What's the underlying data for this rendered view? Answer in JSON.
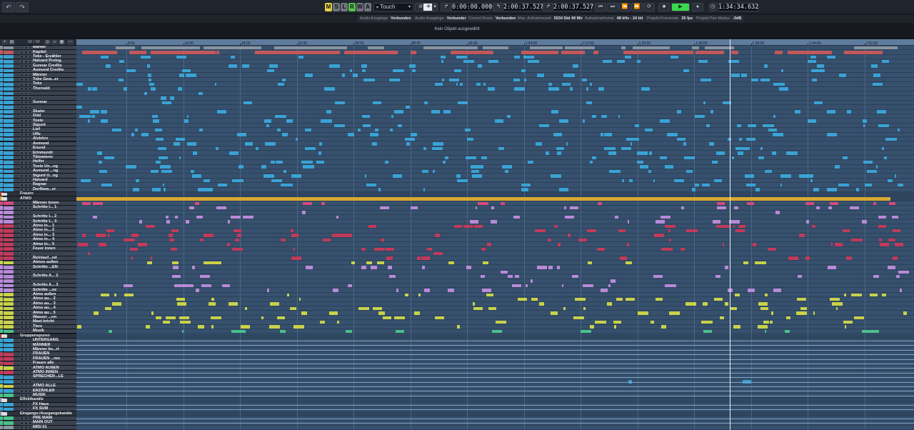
{
  "toolbar": {
    "undo_icon": "undo-icon",
    "redo_icon": "redo-icon",
    "m_label": "M",
    "s_label": "S",
    "l_label": "L",
    "r_label": "R",
    "w_label": "W",
    "a_label": "A",
    "automation_mode": "Touch",
    "time_start": "0:00:00.000",
    "time_left_locator": "2:00:37.527",
    "time_right_locator": "2:00:37.527",
    "time_position": "1:34:34.632",
    "colors": {
      "m": "#e3d14a",
      "s": "#6f757d",
      "l": "#6f757d",
      "r": "#56c150",
      "w": "#6f757d",
      "a": "#6f757d",
      "play": "#3bd94c"
    }
  },
  "status": [
    {
      "label": "Audio-Eingänge",
      "value": "Verbunden"
    },
    {
      "label": "Audio-Ausgänge",
      "value": "Verbunden"
    },
    {
      "label": "Control Room",
      "value": "Verbunden"
    },
    {
      "label": "Max. Aufnahmezeit",
      "value": "5534 Std 49 Min"
    },
    {
      "label": "Aufnahmeformat",
      "value": "48 kHz - 24 bit"
    },
    {
      "label": "Projekt-Framerate",
      "value": "25 fps"
    },
    {
      "label": "Projekt-Pan-Modus",
      "value": "-3dB"
    }
  ],
  "info_line": "Kein Objekt ausgewählt",
  "track_count": "92 / 92",
  "ruler_ticks": [
    "8:00",
    "16:00",
    "24:00",
    "32:00",
    "40:00",
    "48:00",
    "56:00",
    "1:04:00",
    "1:12:00",
    "1:20:00",
    "1:28:00",
    "1:36:00",
    "1:44:00",
    "1:52:00"
  ],
  "tracks": [
    {
      "name": "Marker",
      "color": "#8a94a0",
      "kind": "marker"
    },
    {
      "name": "Kapitel",
      "color": "#c2585a",
      "kind": "marker"
    },
    {
      "name": "Toke - Erzähler",
      "color": "#3aa3d6",
      "kind": "audio"
    },
    {
      "name": "Halvard Prolog",
      "color": "#3aa3d6",
      "kind": "audio"
    },
    {
      "name": "Gunnar Credits",
      "color": "#3aa3d6",
      "kind": "audio"
    },
    {
      "name": "Asmund Credits",
      "color": "#3aa3d6",
      "kind": "audio"
    },
    {
      "name": "Männer",
      "color": "#3aa3d6",
      "kind": "audio"
    },
    {
      "name": "Toke Gew...er",
      "color": "#3aa3d6",
      "kind": "audio"
    },
    {
      "name": "Toke",
      "color": "#3aa3d6",
      "kind": "audio"
    },
    {
      "name": "Thorvald",
      "color": "#3aa3d6",
      "kind": "audio"
    },
    {
      "name": "",
      "color": "#3aa3d6",
      "kind": "audio"
    },
    {
      "name": "",
      "color": "#3aa3d6",
      "kind": "audio"
    },
    {
      "name": "Gunnar",
      "color": "#3aa3d6",
      "kind": "audio"
    },
    {
      "name": "",
      "color": "#3aa3d6",
      "kind": "audio"
    },
    {
      "name": "Skaim",
      "color": "#3aa3d6",
      "kind": "audio"
    },
    {
      "name": "Odd",
      "color": "#3aa3d6",
      "kind": "audio"
    },
    {
      "name": "Toste",
      "color": "#3aa3d6",
      "kind": "audio"
    },
    {
      "name": "Sigurd",
      "color": "#3aa3d6",
      "kind": "audio"
    },
    {
      "name": "Lief",
      "color": "#3aa3d6",
      "kind": "audio"
    },
    {
      "name": "Uffe",
      "color": "#3aa3d6",
      "kind": "audio"
    },
    {
      "name": "Alsbörn",
      "color": "#3aa3d6",
      "kind": "audio"
    },
    {
      "name": "Asmund",
      "color": "#3aa3d6",
      "kind": "audio"
    },
    {
      "name": "Enund",
      "color": "#3aa3d6",
      "kind": "audio"
    },
    {
      "name": "Erinmundr",
      "color": "#3aa3d6",
      "kind": "audio"
    },
    {
      "name": "Tätowierer",
      "color": "#3aa3d6",
      "kind": "audio"
    },
    {
      "name": "Helfer",
      "color": "#3aa3d6",
      "kind": "audio"
    },
    {
      "name": "Toste Un...ng",
      "color": "#3aa3d6",
      "kind": "audio"
    },
    {
      "name": "Asmund ...ng",
      "color": "#3aa3d6",
      "kind": "audio"
    },
    {
      "name": "Sigurd U...ng",
      "color": "#3aa3d6",
      "kind": "audio"
    },
    {
      "name": "Halvard",
      "color": "#3aa3d6",
      "kind": "audio"
    },
    {
      "name": "Ragnar",
      "color": "#3aa3d6",
      "kind": "audio"
    },
    {
      "name": "Dorfbew...er",
      "color": "#3aa3d6",
      "kind": "audio"
    },
    {
      "name": "Frauen",
      "color": "#c23a3a",
      "kind": "folder"
    },
    {
      "name": "ATMO",
      "color": "#d9a832",
      "kind": "folder"
    },
    {
      "name": "Männer innen",
      "color": "#d64a7e",
      "kind": "audio"
    },
    {
      "name": "Schritte I... 1",
      "color": "#b98ad9",
      "kind": "audio"
    },
    {
      "name": "",
      "color": "#b98ad9",
      "kind": "audio"
    },
    {
      "name": "Schritte I... 2",
      "color": "#b98ad9",
      "kind": "audio"
    },
    {
      "name": "Schritte I... 3",
      "color": "#b98ad9",
      "kind": "audio"
    },
    {
      "name": "Atmo in... 1",
      "color": "#c23a5a",
      "kind": "audio"
    },
    {
      "name": "Atmo in... 2",
      "color": "#c23a5a",
      "kind": "audio"
    },
    {
      "name": "Atmo in... 3",
      "color": "#c23a5a",
      "kind": "audio"
    },
    {
      "name": "Atmo in... 4",
      "color": "#c23a5a",
      "kind": "audio"
    },
    {
      "name": "Atmo in... 5",
      "color": "#c23a5a",
      "kind": "audio"
    },
    {
      "name": "Feuer innen",
      "color": "#c23a5a",
      "kind": "audio"
    },
    {
      "name": "",
      "color": "#c23a5a",
      "kind": "audio"
    },
    {
      "name": "Reinlauf...nd",
      "color": "#c23a5a",
      "kind": "audio"
    },
    {
      "name": "Atmos außen",
      "color": "#c9d24a",
      "kind": "audio"
    },
    {
      "name": "Schritte ...EN",
      "color": "#b98ad9",
      "kind": "audio"
    },
    {
      "name": "",
      "color": "#b98ad9",
      "kind": "audio"
    },
    {
      "name": "Schritte A... 2",
      "color": "#b98ad9",
      "kind": "audio"
    },
    {
      "name": "",
      "color": "#b98ad9",
      "kind": "audio"
    },
    {
      "name": "Schritte A... 3",
      "color": "#b98ad9",
      "kind": "audio"
    },
    {
      "name": "Schritte ...ee",
      "color": "#b98ad9",
      "kind": "audio"
    },
    {
      "name": "Atmo außen",
      "color": "#c9d24a",
      "kind": "audio"
    },
    {
      "name": "Atmo au... 2",
      "color": "#c9d24a",
      "kind": "audio"
    },
    {
      "name": "Atmo au... 3",
      "color": "#c9d24a",
      "kind": "audio"
    },
    {
      "name": "Atmo au... 4",
      "color": "#c9d24a",
      "kind": "audio"
    },
    {
      "name": "Atmo au... 5",
      "color": "#c9d24a",
      "kind": "audio"
    },
    {
      "name": "Wasser ...rm",
      "color": "#c9d24a",
      "kind": "audio"
    },
    {
      "name": "Mast bricht",
      "color": "#c9d24a",
      "kind": "audio"
    },
    {
      "name": "Tiere",
      "color": "#c9d24a",
      "kind": "audio"
    },
    {
      "name": "Musik",
      "color": "#4ac28a",
      "kind": "audio"
    },
    {
      "name": "Gruppenspuren",
      "color": "#c23a3a",
      "kind": "folder"
    },
    {
      "name": "UNTERGANG",
      "color": "#3aa3d6",
      "kind": "group"
    },
    {
      "name": "MÄNNER",
      "color": "#3aa3d6",
      "kind": "group"
    },
    {
      "name": "Männer ko...rt",
      "color": "#3aa3d6",
      "kind": "group"
    },
    {
      "name": "FRAUEN",
      "color": "#c23a5a",
      "kind": "group"
    },
    {
      "name": "FRAUEN ...mo",
      "color": "#c23a5a",
      "kind": "group"
    },
    {
      "name": "Frauen alle",
      "color": "#c23a5a",
      "kind": "group"
    },
    {
      "name": "ATMO AUßEN",
      "color": "#c9d24a",
      "kind": "group"
    },
    {
      "name": "ATMO INNEN",
      "color": "#c23a5a",
      "kind": "group"
    },
    {
      "name": "SPRECHER...LE",
      "color": "#3aa3d6",
      "kind": "group"
    },
    {
      "name": "",
      "color": "#3aa3d6",
      "kind": "group"
    },
    {
      "name": "ATMO ALLE",
      "color": "#c9d24a",
      "kind": "group"
    },
    {
      "name": "ERZÄHLER",
      "color": "#3aa3d6",
      "kind": "group"
    },
    {
      "name": "MUSIK",
      "color": "#4ac28a",
      "kind": "group"
    },
    {
      "name": "Effektkanäle",
      "color": "#8a94a0",
      "kind": "folder"
    },
    {
      "name": "FX Haus",
      "color": "#3aa3d6",
      "kind": "fx"
    },
    {
      "name": "FX SUM",
      "color": "#3aa3d6",
      "kind": "fx"
    },
    {
      "name": "Eingangs-/Ausgangskanäle",
      "color": "#8a94a0",
      "kind": "folder"
    },
    {
      "name": "PRE MAIN",
      "color": "#4ac28a",
      "kind": "io"
    },
    {
      "name": "MAIN OUT",
      "color": "#4ac28a",
      "kind": "io"
    },
    {
      "name": "MIDI 01",
      "color": "#8a94a0",
      "kind": "midi"
    }
  ]
}
